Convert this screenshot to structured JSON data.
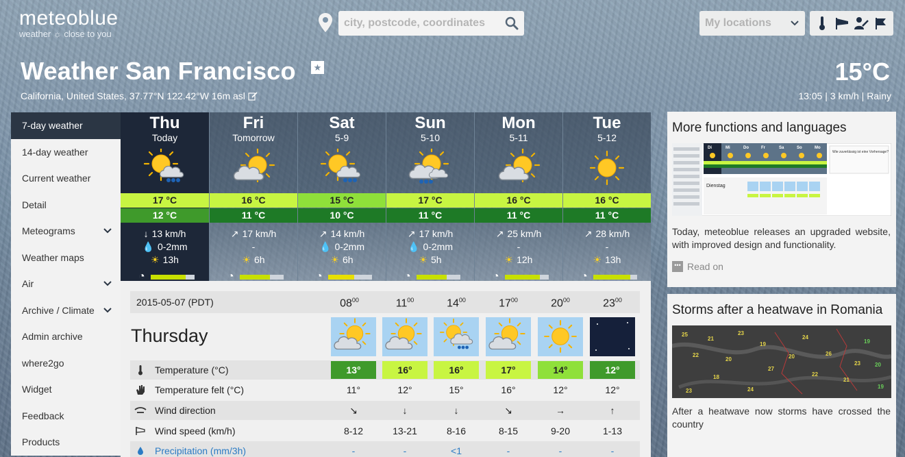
{
  "logo": {
    "main": "meteoblue",
    "sub": "weather ☼ close to you"
  },
  "search": {
    "placeholder": "city, postcode, coordinates"
  },
  "my_locations": "My locations",
  "page": {
    "title": "Weather San Francisco",
    "location": "California, United States, 37.77°N 122.42°W 16m asl",
    "current_temp": "15°C",
    "current_info": "13:05 | 3 km/h | Rainy"
  },
  "sidebar": {
    "items": [
      {
        "label": "7-day weather"
      },
      {
        "label": "14-day weather"
      },
      {
        "label": "Current weather"
      },
      {
        "label": "Detail"
      },
      {
        "label": "Meteograms"
      },
      {
        "label": "Weather maps"
      },
      {
        "label": "Air"
      },
      {
        "label": "Archive / Climate"
      },
      {
        "label": "Admin archive"
      },
      {
        "label": "where2go"
      },
      {
        "label": "Widget"
      },
      {
        "label": "Feedback"
      },
      {
        "label": "Products"
      }
    ]
  },
  "days": [
    {
      "name": "Thu",
      "sub": "Today",
      "icon": "sun-cloud-rain-icon",
      "max": "17 °C",
      "min": "12 °C",
      "max_color": "#c8f542",
      "min_color": "#3f9a2b",
      "wind": "13 km/h",
      "wind_dir": "↓",
      "precip": "0-2mm",
      "sun": "13h",
      "sun_fraction": 0.8,
      "sun_bar_color": "#c8e000"
    },
    {
      "name": "Fri",
      "sub": "Tomorrow",
      "icon": "cloud-sun-icon",
      "max": "16 °C",
      "min": "11 °C",
      "max_color": "#c8f542",
      "min_color": "#1e7a26",
      "wind": "17 km/h",
      "wind_dir": "↗",
      "precip": "-",
      "sun": "6h",
      "sun_fraction": 0.7,
      "sun_bar_color": "#c8e000"
    },
    {
      "name": "Sat",
      "sub": "5-9",
      "icon": "sun-cloud-rain-icon",
      "max": "15 °C",
      "min": "10 °C",
      "max_color": "#8fe03a",
      "min_color": "#1e7a26",
      "wind": "14 km/h",
      "wind_dir": "↗",
      "precip": "0-2mm",
      "sun": "6h",
      "sun_fraction": 0.6,
      "sun_bar_color": "#e8e000"
    },
    {
      "name": "Sun",
      "sub": "5-10",
      "icon": "cloud-sun-rain-icon",
      "max": "17 °C",
      "min": "11 °C",
      "max_color": "#c8f542",
      "min_color": "#1e7a26",
      "wind": "17 km/h",
      "wind_dir": "↗",
      "precip": "0-2mm",
      "sun": "5h",
      "sun_fraction": 0.7,
      "sun_bar_color": "#c8e000"
    },
    {
      "name": "Mon",
      "sub": "5-11",
      "icon": "cloud-sun-icon",
      "max": "16 °C",
      "min": "11 °C",
      "max_color": "#c8f542",
      "min_color": "#1e7a26",
      "wind": "25 km/h",
      "wind_dir": "↗",
      "precip": "-",
      "sun": "12h",
      "sun_fraction": 0.8,
      "sun_bar_color": "#c8e000"
    },
    {
      "name": "Tue",
      "sub": "5-12",
      "icon": "sun-icon",
      "max": "16 °C",
      "min": "11 °C",
      "max_color": "#c8f542",
      "min_color": "#1e7a26",
      "wind": "28 km/h",
      "wind_dir": "↗",
      "precip": "-",
      "sun": "13h",
      "sun_fraction": 0.85,
      "sun_bar_color": "#c8e000"
    }
  ],
  "hourly": {
    "date": "2015-05-07 (PDT)",
    "day_name": "Thursday",
    "hours": [
      {
        "h": "08",
        "m": "00",
        "icon": "sun-cloud-icon",
        "temp": "13°",
        "temp_color": "#3f9a2b",
        "temp_text_color": "#ffffff",
        "felt": "11°",
        "wind_dir": "↘",
        "wind": "8-12",
        "precip": "-"
      },
      {
        "h": "11",
        "m": "00",
        "icon": "sun-cloud-icon",
        "temp": "16°",
        "temp_color": "#c8f542",
        "temp_text_color": "#222222",
        "felt": "12°",
        "wind_dir": "↓",
        "wind": "13-21",
        "precip": "-"
      },
      {
        "h": "14",
        "m": "00",
        "icon": "sun-cloud-rain-icon",
        "temp": "16°",
        "temp_color": "#c8f542",
        "temp_text_color": "#222222",
        "felt": "15°",
        "wind_dir": "↓",
        "wind": "8-16",
        "precip": "<1"
      },
      {
        "h": "17",
        "m": "00",
        "icon": "sun-cloud-icon",
        "temp": "17°",
        "temp_color": "#c8f542",
        "temp_text_color": "#222222",
        "felt": "16°",
        "wind_dir": "↘",
        "wind": "8-15",
        "precip": "-"
      },
      {
        "h": "20",
        "m": "00",
        "icon": "sun-icon",
        "temp": "14°",
        "temp_color": "#8fe03a",
        "temp_text_color": "#222222",
        "felt": "12°",
        "wind_dir": "→",
        "wind": "9-20",
        "precip": "-"
      },
      {
        "h": "23",
        "m": "00",
        "icon": "moon-icon",
        "temp": "12°",
        "temp_color": "#3f9a2b",
        "temp_text_color": "#ffffff",
        "felt": "12°",
        "wind_dir": "↑",
        "wind": "1-13",
        "precip": "-"
      }
    ],
    "params": [
      "Temperature (°C)",
      "Temperature felt (°C)",
      "Wind direction",
      "Wind speed (km/h)",
      "Precipitation (mm/3h)"
    ]
  },
  "cards": [
    {
      "title": "More functions and languages",
      "text": "Today, meteoblue releases an upgraded website, with improved design and functionality.",
      "readon": "Read on",
      "screenshot_days": [
        "Di",
        "Mi",
        "Do",
        "Fr",
        "Sa",
        "So",
        "Mo"
      ],
      "screenshot_label": "Dienstag",
      "screenshot_note": "Wie zuverlässig ist eine Vorhersage?"
    },
    {
      "title": "Storms after a heatwave in Romania",
      "text": "After a heatwave now storms have crossed the country",
      "map_values": [
        "25",
        "21",
        "23",
        "19",
        "22",
        "20",
        "24",
        "26",
        "18",
        "27"
      ]
    }
  ],
  "colors": {
    "accent": "#2b3644",
    "selected_day": "#1d2738"
  }
}
